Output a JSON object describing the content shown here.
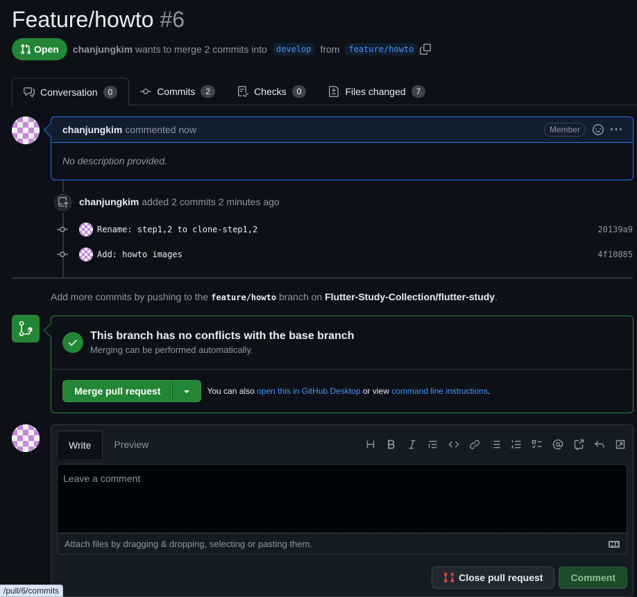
{
  "header": {
    "title": "Feature/howto",
    "number": "#6",
    "state": "Open",
    "author": "chanjungkim",
    "summary": "wants to merge 2 commits into",
    "base_branch": "develop",
    "from_word": "from",
    "head_branch": "feature/howto"
  },
  "tabs": [
    {
      "label": "Conversation",
      "count": "0"
    },
    {
      "label": "Commits",
      "count": "2"
    },
    {
      "label": "Checks",
      "count": "0"
    },
    {
      "label": "Files changed",
      "count": "7"
    }
  ],
  "comment": {
    "author": "chanjungkim",
    "action": "commented now",
    "badge": "Member",
    "body": "No description provided."
  },
  "push_event": {
    "author": "chanjungkim",
    "text": "added 2 commits 2 minutes ago"
  },
  "commits": [
    {
      "message": "Rename: step1,2 to clone-step1,2",
      "sha": "20139a9"
    },
    {
      "message": "Add: howto images",
      "sha": "4f10885"
    }
  ],
  "push_hint": {
    "prefix": "Add more commits by pushing to the",
    "branch": "feature/howto",
    "middle": "branch on",
    "repo": "Flutter-Study-Collection/flutter-study",
    "suffix": "."
  },
  "merge": {
    "title": "This branch has no conflicts with the base branch",
    "subtitle": "Merging can be performed automatically.",
    "button": "Merge pull request",
    "also_text": "You can also",
    "desktop_link": "open this in GitHub Desktop",
    "or_view": "or view",
    "cli_link": "command line instructions",
    "period": "."
  },
  "editor": {
    "tab_write": "Write",
    "tab_preview": "Preview",
    "placeholder": "Leave a comment",
    "attach_hint": "Attach files by dragging & dropping, selecting or pasting them.",
    "close_button": "Close pull request",
    "comment_button": "Comment",
    "toolbar_icons": [
      "heading-icon",
      "bold-icon",
      "italic-icon",
      "quote-icon",
      "code-icon",
      "link-icon",
      "unordered-list-icon",
      "ordered-list-icon",
      "task-list-icon",
      "mention-icon",
      "cross-reference-icon",
      "reply-icon",
      "fullscreen-icon"
    ]
  },
  "status_bar": {
    "url": "/pull/6/commits"
  },
  "colors": {
    "background": "#0d1117",
    "accent_green": "#238636",
    "accent_blue": "#1f6feb",
    "link": "#4493f8",
    "muted": "#8d96a0"
  }
}
